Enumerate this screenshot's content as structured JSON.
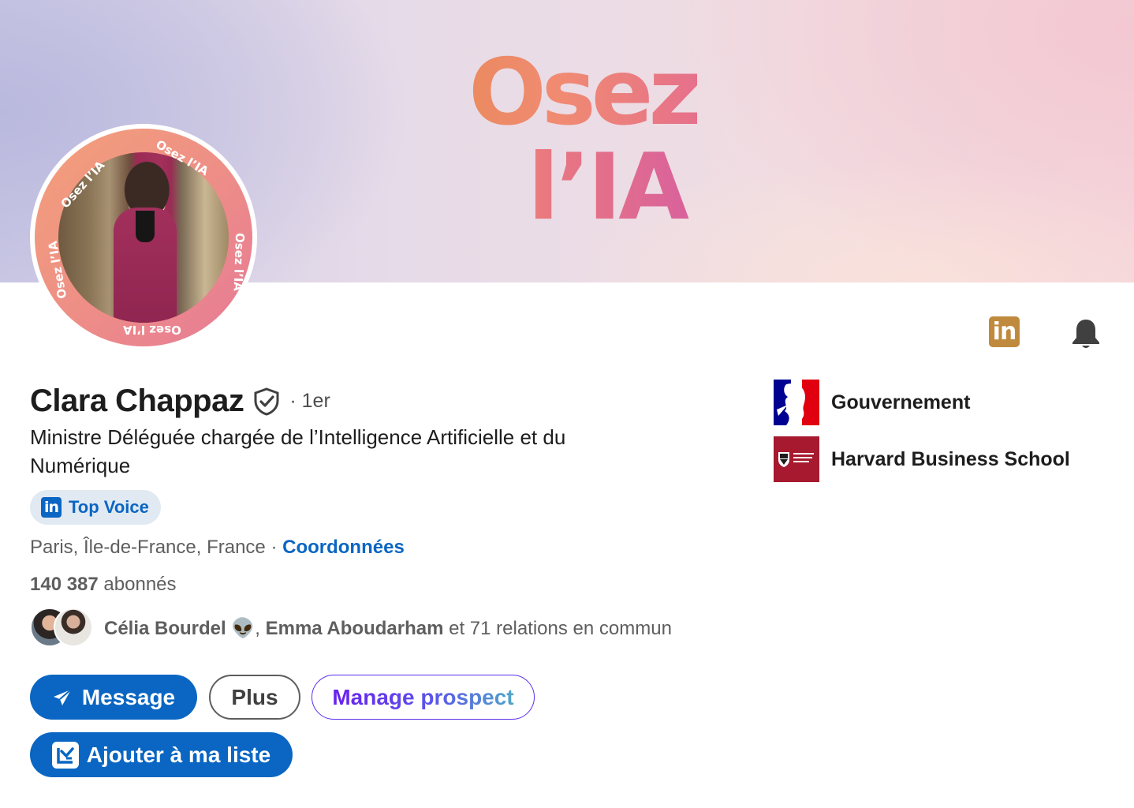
{
  "banner": {
    "line1": "Osez",
    "line2": "l’IA"
  },
  "avatar": {
    "ring_text": "Osez l’IA"
  },
  "profile": {
    "name": "Clara Chappaz",
    "degree": "· 1er",
    "headline": "Ministre Déléguée chargée de l’Intelligence Artificielle et du Numérique",
    "badge_label": "Top Voice",
    "location": "Paris, Île-de-France, France",
    "location_sep": " · ",
    "contact_link": "Coordonnées",
    "followers_count": "140 387",
    "followers_label": " abonnés"
  },
  "mutual": {
    "name1": "Célia Bourdel",
    "emoji": " 👽",
    "sep": ", ",
    "name2": "Emma Aboudarham",
    "rest": " et 71 relations en commun"
  },
  "actions": {
    "message": "Message",
    "more": "Plus",
    "manage_prospect": "Manage prospect",
    "add_to_list": "Ajouter à ma liste"
  },
  "top_icons": {
    "linkedin": "in"
  },
  "organizations": [
    {
      "name": "Gouvernement"
    },
    {
      "name": "Harvard Business School"
    }
  ],
  "colors": {
    "accent_blue": "#0a66c2",
    "linkedin_gold": "#c08a3e",
    "hbs_crimson": "#a6192e"
  }
}
